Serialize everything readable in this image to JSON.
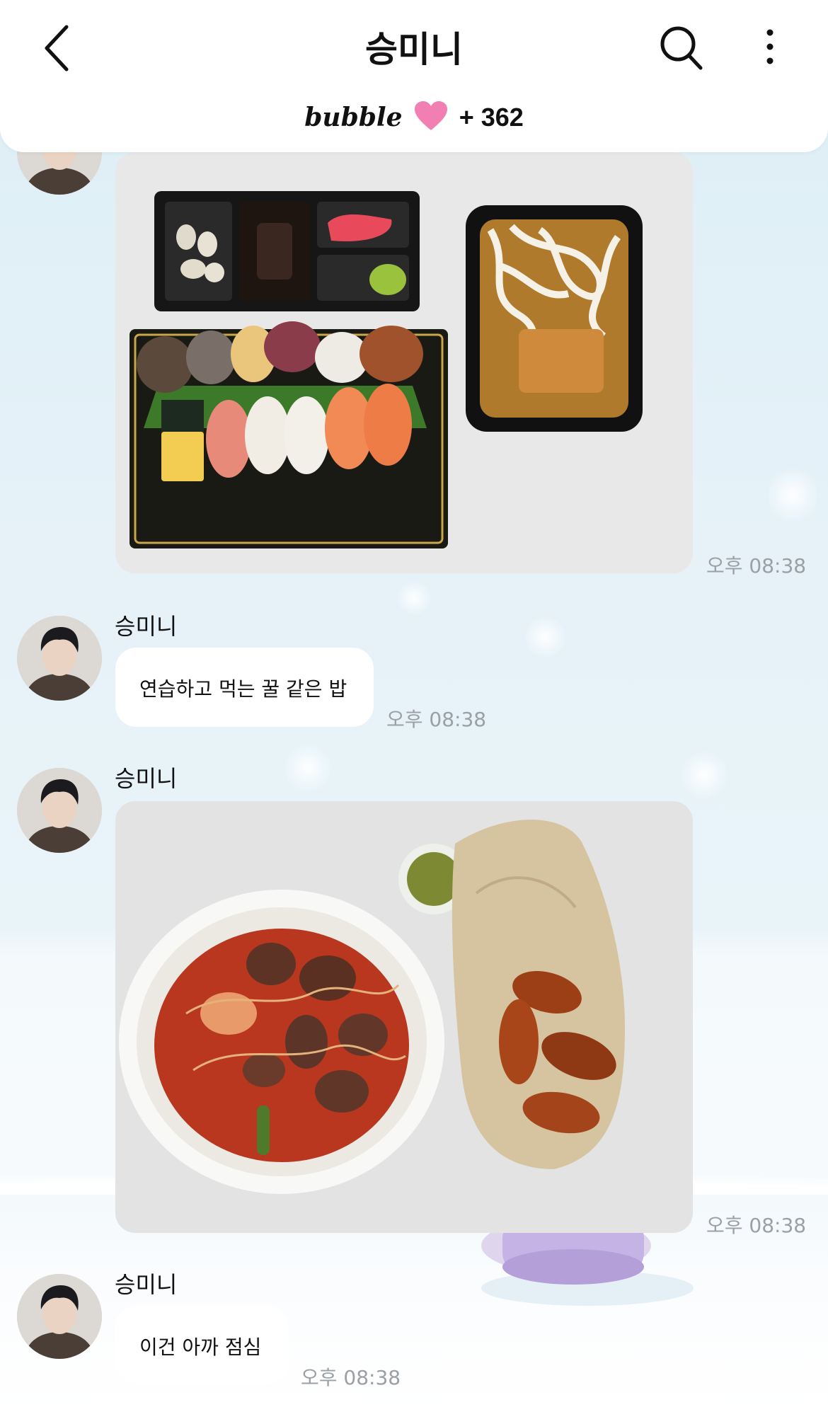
{
  "header": {
    "title": "승미니",
    "bubble_logo": "bubble",
    "count": "+ 362"
  },
  "messages": [
    {
      "type": "photo",
      "time": "오후 08:38"
    },
    {
      "type": "text",
      "sender": "승미니",
      "text": "연습하고 먹는 꿀 같은 밥",
      "time": "오후 08:38"
    },
    {
      "type": "photo",
      "sender": "승미니",
      "time": "오후 08:38"
    },
    {
      "type": "text",
      "sender": "승미니",
      "text": "이건 아까 점심",
      "time": "오후 08:38"
    }
  ],
  "icons": {
    "back": "chevron-left-icon",
    "search": "search-icon",
    "more": "more-vertical-icon",
    "heart": "heart-icon"
  },
  "colors": {
    "header_bg": "#ffffff",
    "heart": "#f27fb4",
    "time": "#9aa0a6",
    "bubble_bg": "#ffffff"
  }
}
